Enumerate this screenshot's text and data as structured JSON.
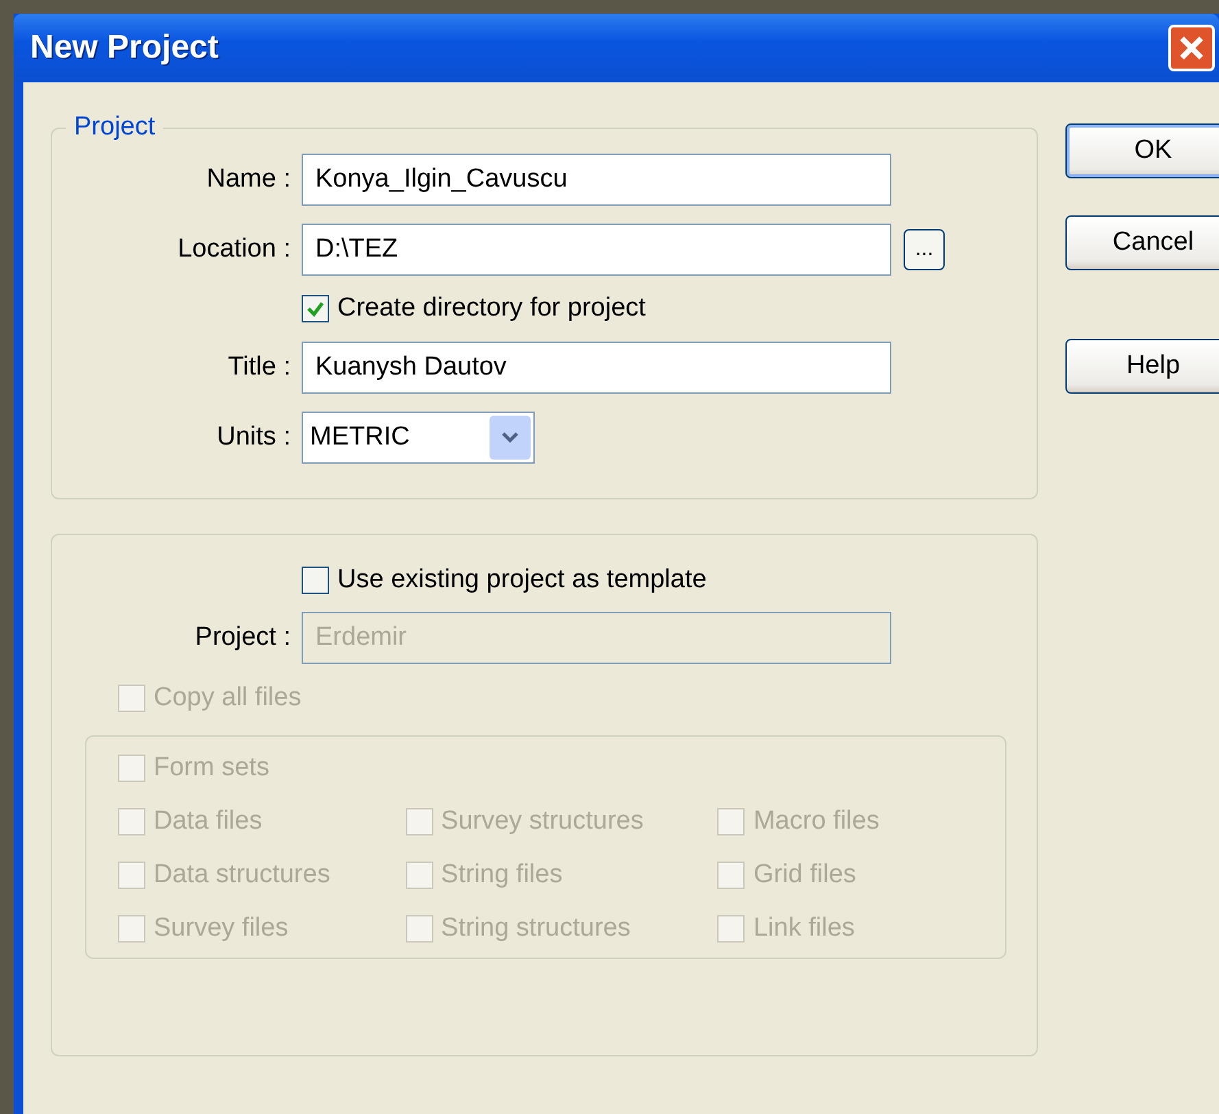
{
  "window": {
    "title": "New Project"
  },
  "project_group": {
    "legend": "Project",
    "rows": [
      {
        "kind": "text",
        "label": "Name :",
        "value": "Konya_Ilgin_Cavuscu"
      },
      {
        "kind": "browse",
        "label": "Location :",
        "value": "D:\\TEZ",
        "button": "..."
      },
      {
        "kind": "checkbox",
        "label": "Create directory for project",
        "checked": true
      },
      {
        "kind": "text",
        "label": "Title :",
        "value": "Kuanysh Dautov"
      },
      {
        "kind": "select",
        "label": "Units :",
        "value": "METRIC"
      }
    ]
  },
  "template_group": {
    "use_template": {
      "label": "Use existing project as template",
      "checked": false
    },
    "project_field": {
      "label": "Project :",
      "value": "Erdemir",
      "disabled": true
    },
    "copy_all": {
      "label": "Copy all files",
      "checked": false,
      "disabled": true
    },
    "file_rows": [
      [
        {
          "label": "Form sets",
          "checked": false,
          "disabled": true
        }
      ],
      [
        {
          "label": "Data files",
          "checked": false,
          "disabled": true
        },
        {
          "label": "Survey structures",
          "checked": false,
          "disabled": true
        },
        {
          "label": "Macro files",
          "checked": false,
          "disabled": true
        }
      ],
      [
        {
          "label": "Data structures",
          "checked": false,
          "disabled": true
        },
        {
          "label": "String files",
          "checked": false,
          "disabled": true
        },
        {
          "label": "Grid files",
          "checked": false,
          "disabled": true
        }
      ],
      [
        {
          "label": "Survey files",
          "checked": false,
          "disabled": true
        },
        {
          "label": "String structures",
          "checked": false,
          "disabled": true
        },
        {
          "label": "Link files",
          "checked": false,
          "disabled": true
        }
      ]
    ]
  },
  "buttons": [
    {
      "label": "OK",
      "default": true
    },
    {
      "label": "Cancel",
      "default": false
    },
    {
      "label": "Help",
      "default": false
    }
  ]
}
